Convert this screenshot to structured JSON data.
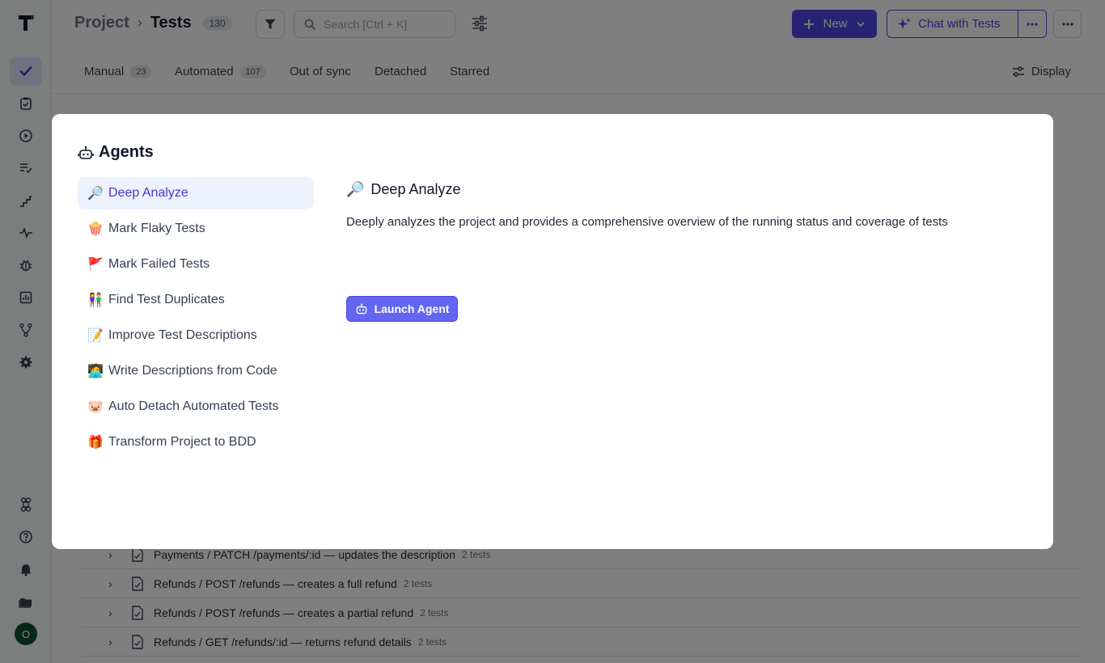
{
  "header": {
    "breadcrumb_project": "Project",
    "breadcrumb_sep": "›",
    "breadcrumb_tests": "Tests",
    "tests_count": "130",
    "search_placeholder": "Search [Ctrl + K]",
    "new_label": "New",
    "chat_label": "Chat with Tests"
  },
  "tabs": {
    "manual": "Manual",
    "manual_count": "23",
    "automated": "Automated",
    "automated_count": "107",
    "out_of_sync": "Out of sync",
    "detached": "Detached",
    "starred": "Starred",
    "display": "Display"
  },
  "sidebar": {
    "avatar_initial": "O",
    "icons": [
      "check-icon",
      "clipboard-check-icon",
      "play-circle-icon",
      "list-check-icon",
      "stairs-icon",
      "pulse-icon",
      "bug-icon",
      "bar-chart-icon",
      "git-branch-icon",
      "gear-icon",
      "command-icon",
      "help-icon",
      "bell-icon",
      "folder-icon"
    ]
  },
  "list": {
    "rows": [
      {
        "title": "Payments / PATCH /payments/:id — updates the description",
        "count": "2 tests"
      },
      {
        "title": "Refunds / POST /refunds — creates a full refund",
        "count": "2 tests"
      },
      {
        "title": "Refunds / POST /refunds — creates a partial refund",
        "count": "2 tests"
      },
      {
        "title": "Refunds / GET /refunds/:id — returns refund details",
        "count": "2 tests"
      }
    ]
  },
  "modal": {
    "title": "Agents",
    "agents": [
      {
        "emoji": "🔎",
        "label": "Deep Analyze"
      },
      {
        "emoji": "🍿",
        "label": "Mark Flaky Tests"
      },
      {
        "emoji": "🚩",
        "label": "Mark Failed Tests"
      },
      {
        "emoji": "👫",
        "label": "Find Test Duplicates"
      },
      {
        "emoji": "📝",
        "label": "Improve Test Descriptions"
      },
      {
        "emoji": "🧑‍💻",
        "label": "Write Descriptions from Code"
      },
      {
        "emoji": "🐷",
        "label": "Auto Detach Automated Tests"
      },
      {
        "emoji": "🎁",
        "label": "Transform Project to BDD"
      }
    ],
    "detail": {
      "emoji": "🔎",
      "title": "Deep Analyze",
      "description": "Deeply analyzes the project and provides a comprehensive overview of the running status and coverage of tests",
      "launch_label": "Launch Agent"
    }
  },
  "colors": {
    "accent": "#4f46e5",
    "active_nav": "#e0e7ff",
    "avatar": "#0f5132"
  }
}
